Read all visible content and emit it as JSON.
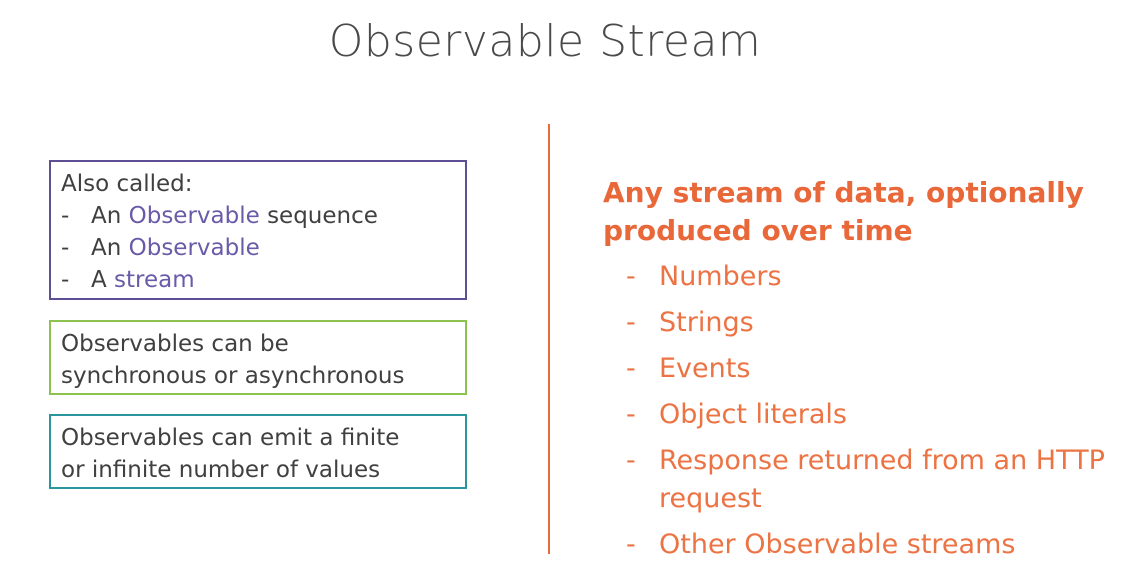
{
  "title": "Observable Stream",
  "also_box": {
    "heading": "Also called:",
    "items": [
      {
        "dash": "-",
        "prefix": "An ",
        "accent": "Observable",
        "suffix": " sequence"
      },
      {
        "dash": "-",
        "prefix": "An ",
        "accent": "Observable",
        "suffix": ""
      },
      {
        "dash": "-",
        "prefix": "A ",
        "accent": "stream",
        "suffix": ""
      }
    ]
  },
  "sync_box": {
    "line1": "Observables can be",
    "line2": "synchronous or asynchronous"
  },
  "finite_box": {
    "line1": "Observables can emit a finite",
    "line2": "or infinite number of values"
  },
  "right": {
    "headline_line1": "Any stream of data, optionally",
    "headline_line2": "produced over time",
    "items": [
      {
        "dash": "-",
        "text": "Numbers"
      },
      {
        "dash": "-",
        "text": "Strings"
      },
      {
        "dash": "-",
        "text": "Events"
      },
      {
        "dash": "-",
        "text": "Object literals"
      },
      {
        "dash": "-",
        "text": "Response returned from an HTTP request"
      },
      {
        "dash": "-",
        "text": "Other Observable streams"
      }
    ]
  },
  "colors": {
    "purple_border": "#5e4f95",
    "green_border": "#8cc24d",
    "teal_border": "#29969f",
    "accent_purple": "#6a5ba8",
    "orange": "#e9683a"
  }
}
